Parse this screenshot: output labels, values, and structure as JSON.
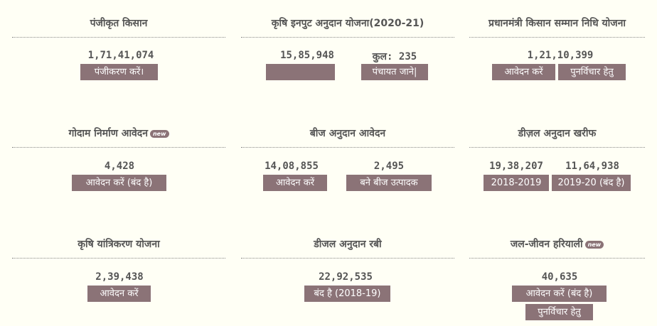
{
  "panels": [
    {
      "title": "पंजीकृत किसान",
      "value": "1,71,41,074",
      "button": "पंजीकरण करें।"
    },
    {
      "title": "कृषि इनपुट अनुदान योजना(2020-21)",
      "value": "15,85,948",
      "total": "कुल: 235",
      "button_blank": "",
      "button": "पंचायत जाने|"
    },
    {
      "title": "प्रधानमंत्री किसान सम्मान निधि योजना",
      "value": "1,21,10,399",
      "button_apply": "आवेदन करें",
      "button_review": "पुनर्विचार हेतु"
    },
    {
      "title": "गोदाम निर्माण आवेदन",
      "badge": "new",
      "value": "4,428",
      "button": "आवेदन करें (बंद है)"
    },
    {
      "title": "बीज अनुदान आवेदन",
      "value_apply": "14,08,855",
      "value_producer": "2,495",
      "button_apply": "आवेदन करें",
      "button_producer": "बने बीज उत्पादक"
    },
    {
      "title": "डीज़ल अनुदान खरीफ",
      "value_2018": "19,38,207",
      "value_2019": "11,64,938",
      "button_2018": "2018-2019",
      "button_2019": "2019-20 (बंद है)"
    },
    {
      "title": "कृषि यांत्रिकरण योजना",
      "value": "2,39,438",
      "button": "आवेदन करें"
    },
    {
      "title": "डीजल अनुदान रबी",
      "value": "22,92,535",
      "button": "बंद है (2018-19)"
    },
    {
      "title": "जल-जीवन हरियाली",
      "badge": "new",
      "value": "40,635",
      "button_apply": "आवेदन करें (बंद है)",
      "button_review": "पुनर्विचार हेतु"
    }
  ],
  "colors": {
    "button": "#8b7377",
    "background": "#fffff5",
    "badge": "#8b7377"
  }
}
